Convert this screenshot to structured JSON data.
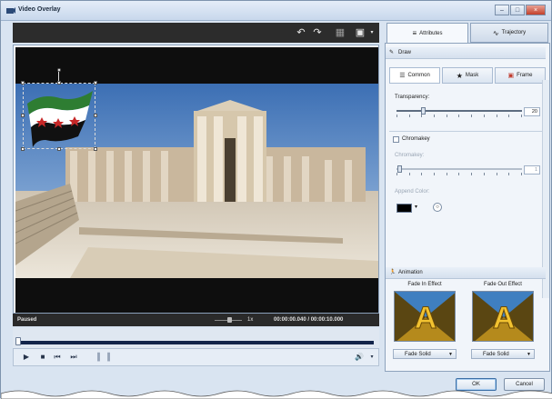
{
  "window": {
    "title": "Video Overlay",
    "controls": [
      "–",
      "□",
      "×"
    ]
  },
  "toolbar": {
    "icons": [
      "undo-icon",
      "redo-icon",
      "grid-icon",
      "screen-icon"
    ]
  },
  "preview": {
    "status": "Paused",
    "speed": "1x",
    "timecode": "00:00:00.040 / 00:00:10.000",
    "playhead_fraction": 0
  },
  "transport": {
    "icons": [
      "play-icon",
      "stop-icon",
      "prev-frame-icon",
      "next-frame-icon",
      "mark-in-icon",
      "mark-out-icon",
      "volume-icon"
    ]
  },
  "tabs": {
    "attributes": "Attributes",
    "trajectory": "Trajectory"
  },
  "draw": {
    "header": "Draw",
    "subtabs": [
      "Common",
      "Mask",
      "Frame"
    ],
    "transparency_label": "Transparency:",
    "transparency_value": "20",
    "transparency_fraction": 0.2,
    "chromakey_check_label": "Chromakey",
    "chromakey_checked": false,
    "chromakey_label": "Chromakey:",
    "chromakey_value": "1",
    "chromakey_fraction": 0.01,
    "append_color_label": "Append Color:",
    "append_color": "#000000"
  },
  "animation": {
    "header": "Animation",
    "fade_in_label": "Fade In Effect",
    "fade_out_label": "Fade Out Effect",
    "fade_in_value": "Fade Solid",
    "fade_out_value": "Fade Solid"
  },
  "footer": {
    "ok": "OK",
    "cancel": "Cancel"
  },
  "colors": {
    "accent": "#12244a",
    "panel": "#f1f5fa",
    "titlebar": "#d2e0f0"
  }
}
